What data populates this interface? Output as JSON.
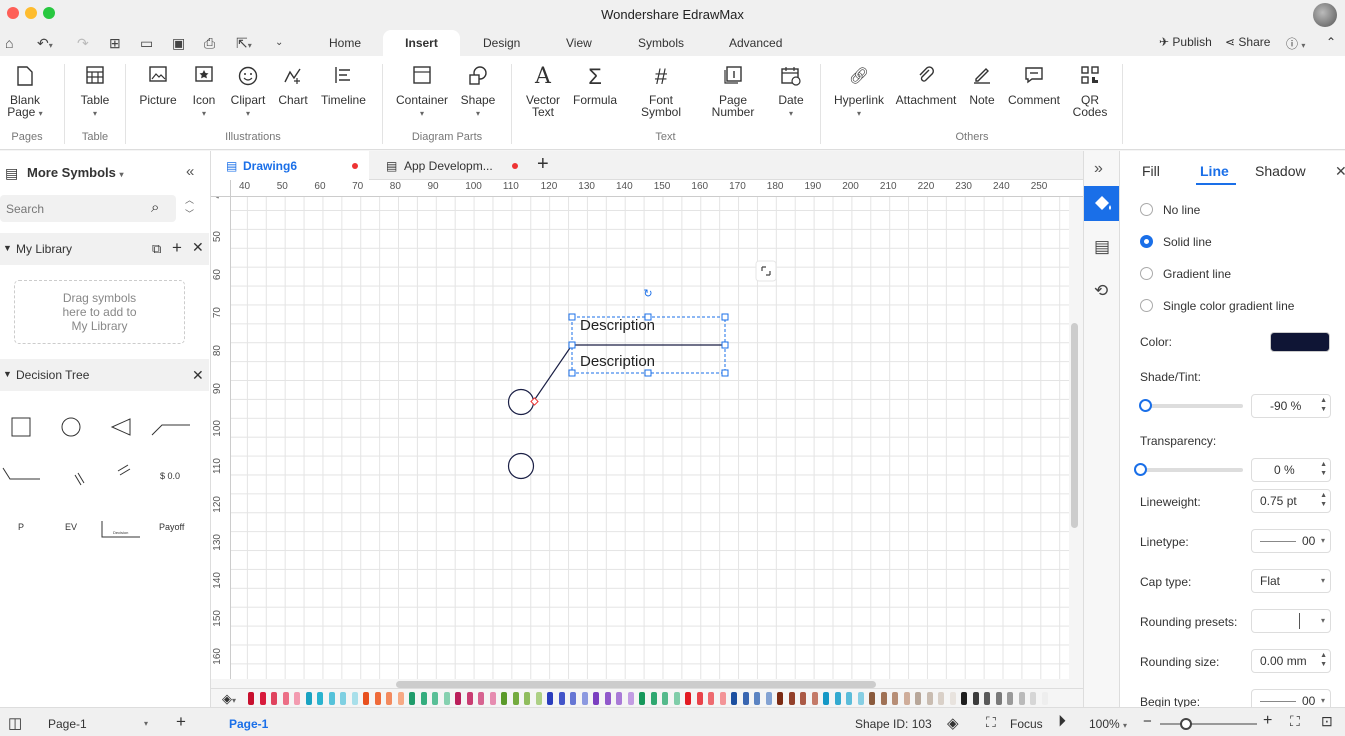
{
  "window": {
    "title": "Wondershare EdrawMax"
  },
  "menu": {
    "tabs": [
      "Home",
      "Insert",
      "Design",
      "View",
      "Symbols",
      "Advanced"
    ],
    "active_tab": "Insert",
    "publish": "Publish",
    "share": "Share"
  },
  "ribbon": {
    "buttons": {
      "blank_page": "Blank\nPage",
      "table": "Table",
      "picture": "Picture",
      "icon": "Icon",
      "clipart": "Clipart",
      "chart": "Chart",
      "timeline": "Timeline",
      "container": "Container",
      "shape": "Shape",
      "vector_text": "Vector\nText",
      "formula": "Formula",
      "font_symbol": "Font\nSymbol",
      "page_number": "Page\nNumber",
      "date": "Date",
      "hyperlink": "Hyperlink",
      "attachment": "Attachment",
      "note": "Note",
      "comment": "Comment",
      "qr_codes": "QR\nCodes"
    },
    "groups": {
      "pages": "Pages",
      "table": "Table",
      "illustrations": "Illustrations",
      "diagram_parts": "Diagram Parts",
      "text": "Text",
      "others": "Others"
    }
  },
  "left_panel": {
    "title": "More Symbols",
    "search_placeholder": "Search",
    "my_library": "My Library",
    "drop_hint": "Drag symbols\nhere to add to\nMy Library",
    "decision_tree": "Decision Tree",
    "symbol_labels": {
      "dollar": "$ 0.0",
      "p": "P",
      "ev": "EV",
      "decision": "Decision",
      "payoff": "Payoff"
    }
  },
  "documents": {
    "tabs": [
      "Drawing6",
      "App Developm..."
    ],
    "active": "Drawing6"
  },
  "rulers": {
    "h": [
      "40",
      "50",
      "60",
      "70",
      "80",
      "90",
      "100",
      "110",
      "120",
      "130",
      "140",
      "150",
      "160",
      "170",
      "180",
      "190",
      "200",
      "210",
      "220",
      "230",
      "240",
      "250"
    ],
    "v": [
      "4",
      "50",
      "60",
      "70",
      "80",
      "90",
      "100",
      "110",
      "120",
      "130",
      "140",
      "150",
      "160"
    ]
  },
  "canvas": {
    "text1": "Description",
    "text2": "Description"
  },
  "right_panel": {
    "tabs": [
      "Fill",
      "Line",
      "Shadow"
    ],
    "active_tab": "Line",
    "line_options": [
      "No line",
      "Solid line",
      "Gradient line",
      "Single color gradient line"
    ],
    "selected_option": "Solid line",
    "color_label": "Color:",
    "color_value": "#0f1535",
    "shade_label": "Shade/Tint:",
    "shade_value": "-90 %",
    "shade_level": -0.9,
    "transparency_label": "Transparency:",
    "transparency_value": "0 %",
    "transparency_level": 0,
    "lineweight_label": "Lineweight:",
    "lineweight_value": "0.75 pt",
    "linetype_label": "Linetype:",
    "linetype_value": "00",
    "cap_label": "Cap type:",
    "cap_value": "Flat",
    "rounding_presets_label": "Rounding presets:",
    "rounding_size_label": "Rounding size:",
    "rounding_size_value": "0.00 mm",
    "begin_type_label": "Begin type:",
    "begin_type_value": "00"
  },
  "status": {
    "page_select": "Page-1",
    "page_tab": "Page-1",
    "shape_id": "Shape ID: 103",
    "focus": "Focus",
    "zoom": "100%"
  },
  "palette_colors": [
    "#c8102e",
    "#d81b3c",
    "#e0435e",
    "#ec6f86",
    "#f39bb0",
    "#1aa3c2",
    "#2ab3cf",
    "#55c2da",
    "#7fd0e2",
    "#a8dfea",
    "#e8501e",
    "#ef6b3a",
    "#f38a5e",
    "#f7aa85",
    "#1f9c6b",
    "#34ad7e",
    "#59bf97",
    "#86d1b0",
    "#bb1f5b",
    "#c93d72",
    "#d76491",
    "#e68cb0",
    "#5b9a2a",
    "#74ab3f",
    "#90bd5e",
    "#add085",
    "#2a3dbd",
    "#4355c9",
    "#6676d4",
    "#8c99e0",
    "#7b3fc0",
    "#9159cb",
    "#a97ad7",
    "#c39de3",
    "#16985b",
    "#2fa871",
    "#55ba8c",
    "#80cda9",
    "#e31b23",
    "#e9434a",
    "#ee6b70",
    "#f39497",
    "#1c4fa0",
    "#3966b1",
    "#5c84c2",
    "#84a3d3",
    "#7b2a12",
    "#93402a",
    "#ab5a46",
    "#c47a68",
    "#1598c6",
    "#34aad0",
    "#5cbdda",
    "#87cfe4",
    "#8a5a3c",
    "#a07256",
    "#b78e76",
    "#cfad9a",
    "#b8a79a",
    "#c9bcb1",
    "#d9d0c8",
    "#e8e3de",
    "#1e1e1e",
    "#3c3c3c",
    "#5a5a5a",
    "#7a7a7a",
    "#9a9a9a",
    "#bababa",
    "#d6d6d6",
    "#eeeeee"
  ]
}
